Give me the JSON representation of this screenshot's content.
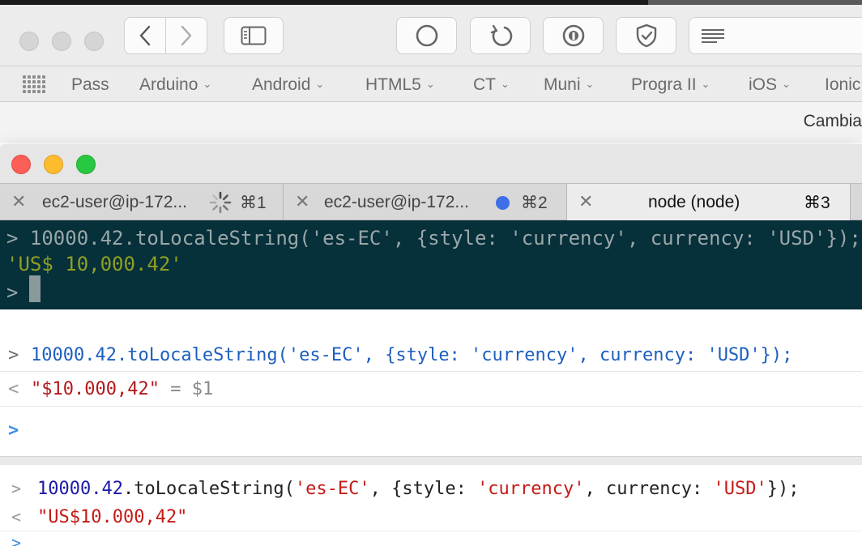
{
  "colors": {
    "terminal_bg": "#06303a",
    "terminal_result": "#8fa022",
    "safari_console_blue": "#1d5fbf",
    "safari_console_red": "#b2181b",
    "chrome_string_red": "#c41a16",
    "chrome_number_blue": "#1a1aa6",
    "close_red": "#fc5f57",
    "minimize_yellow": "#fdbc2e",
    "zoom_green": "#28c840",
    "tab_dot_blue": "#3f6fe8"
  },
  "browser": {
    "toolbar_icons": [
      "back-icon",
      "forward-icon",
      "sidebar-icon",
      "stop-icon",
      "reload-icon",
      "password-icon",
      "shield-icon",
      "reader-icon"
    ],
    "favorites": [
      {
        "label": "Pass",
        "has_menu": false
      },
      {
        "label": "Arduino",
        "has_menu": true
      },
      {
        "label": "Android",
        "has_menu": true
      },
      {
        "label": "HTML5",
        "has_menu": true
      },
      {
        "label": "CT",
        "has_menu": true
      },
      {
        "label": "Muni",
        "has_menu": true
      },
      {
        "label": "Progra II",
        "has_menu": true
      },
      {
        "label": "iOS",
        "has_menu": true
      },
      {
        "label": "Ionic",
        "has_menu": false
      }
    ],
    "subbar_text": "Cambia"
  },
  "terminal": {
    "tabs": [
      {
        "title": "ec2-user@ip-172...",
        "shortcut": "⌘1",
        "status": "spinner"
      },
      {
        "title": "ec2-user@ip-172...",
        "shortcut": "⌘2",
        "status": "dot"
      },
      {
        "title": "node (node)",
        "shortcut": "⌘3",
        "status": "active"
      }
    ],
    "prompt": ">",
    "command": "10000.42.toLocaleString('es-EC', {style: 'currency', currency: 'USD'});",
    "result": "'US$ 10,000.42'"
  },
  "safari_console": {
    "prompt_in": ">",
    "prompt_out": "<",
    "command": "10000.42.toLocaleString('es-EC', {style: 'currency', currency: 'USD'});",
    "result": "\"$10.000,42\"",
    "result_ref": "= $1"
  },
  "chrome_console": {
    "prompt_in": ">",
    "prompt_out": "<",
    "cmd_number": "10000.42",
    "cmd_method": ".toLocaleString(",
    "cmd_arg1": "'es-EC'",
    "cmd_mid1": ", {style: ",
    "cmd_arg2": "'currency'",
    "cmd_mid2": ", currency: ",
    "cmd_arg3": "'USD'",
    "cmd_end": "});",
    "result": "\"US$10.000,42\""
  }
}
